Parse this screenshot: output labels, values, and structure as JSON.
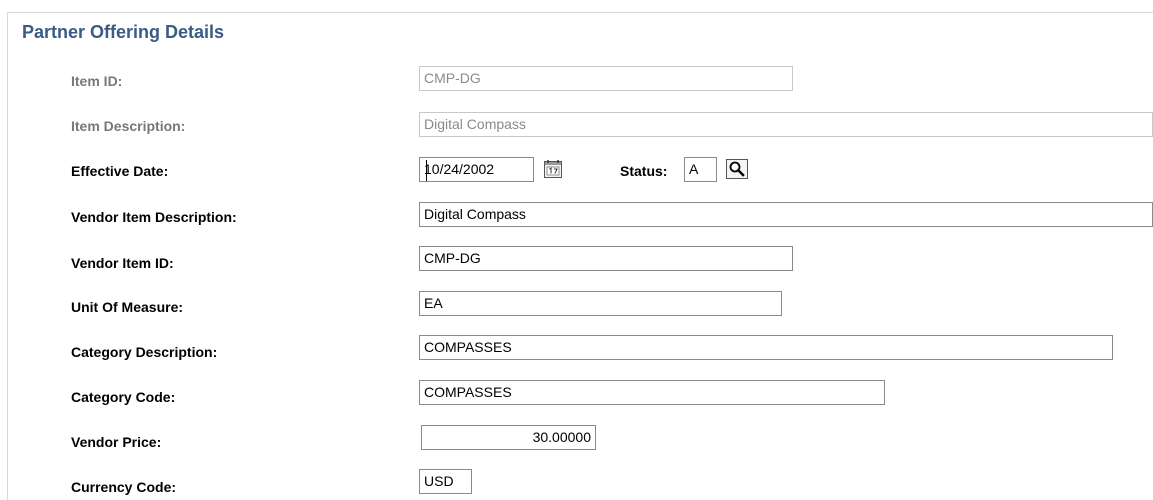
{
  "section": {
    "title": "Partner Offering Details"
  },
  "fields": {
    "item_id": {
      "label": "Item ID:",
      "value": "CMP-DG"
    },
    "item_description": {
      "label": "Item Description:",
      "value": "Digital Compass"
    },
    "effective_date": {
      "label": "Effective Date:",
      "value": "10/24/2002"
    },
    "status": {
      "label": "Status:",
      "value": "A"
    },
    "vendor_item_description": {
      "label": "Vendor Item Description:",
      "value": "Digital Compass"
    },
    "vendor_item_id": {
      "label": "Vendor Item ID:",
      "value": "CMP-DG"
    },
    "unit_of_measure": {
      "label": "Unit Of Measure:",
      "value": "EA"
    },
    "category_description": {
      "label": "Category Description:",
      "value": "COMPASSES"
    },
    "category_code": {
      "label": "Category Code:",
      "value": "COMPASSES"
    },
    "vendor_price": {
      "label": "Vendor Price:",
      "value": "30.00000"
    },
    "currency_code": {
      "label": "Currency Code:",
      "value": "USD"
    }
  },
  "icons": {
    "calendar": "calendar-icon",
    "lookup": "magnifier-lookup-icon"
  }
}
